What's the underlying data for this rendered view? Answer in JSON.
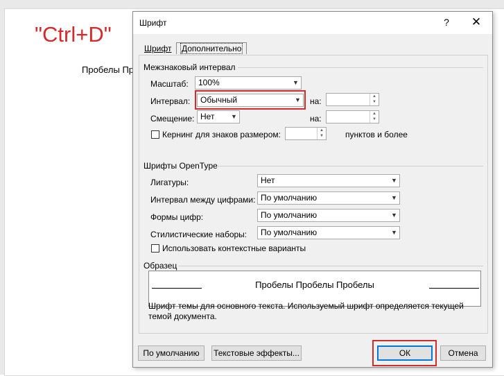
{
  "annotation": {
    "shortcut": "\"Ctrl+D\""
  },
  "document": {
    "text": "Пробелы Пр"
  },
  "dialog": {
    "title": "Шрифт",
    "help_glyph": "?",
    "close_glyph": "✕",
    "tabs": [
      {
        "label": "Шрифт"
      },
      {
        "label": "Дополнительно"
      }
    ],
    "spacing_section": {
      "header": "Межзнаковый интервал",
      "scale_label": "Масштаб:",
      "scale_value": "100%",
      "spacing_label": "Интервал:",
      "spacing_value": "Обычный",
      "spacing_by_label": "на:",
      "spacing_by_value": "",
      "position_label": "Смещение:",
      "position_value": "Нет",
      "position_by_label": "на:",
      "position_by_value": "",
      "kerning_label": "Кернинг для знаков размером:",
      "kerning_value": "",
      "kerning_suffix": "пунктов и более"
    },
    "opentype_section": {
      "header": "Шрифты OpenType",
      "rows": [
        {
          "label": "Лигатуры:",
          "value": "Нет"
        },
        {
          "label": "Интервал между цифрами:",
          "value": "По умолчанию"
        },
        {
          "label": "Формы цифр:",
          "value": "По умолчанию"
        },
        {
          "label": "Стилистические наборы:",
          "value": "По умолчанию"
        }
      ],
      "contextual_label": "Использовать контекстные варианты"
    },
    "preview_section": {
      "header": "Образец",
      "sample_text": "Пробелы Пробелы Пробелы",
      "description": "Шрифт темы для основного текста. Используемый шрифт определяется текущей темой документа."
    },
    "buttons": {
      "default": "По умолчанию",
      "text_effects": "Текстовые эффекты...",
      "ok": "ОК",
      "cancel": "Отмена"
    }
  },
  "colors": {
    "highlight": "#d42a2a",
    "dialog_bg": "#f0f0f0",
    "accent": "#0078d7"
  }
}
